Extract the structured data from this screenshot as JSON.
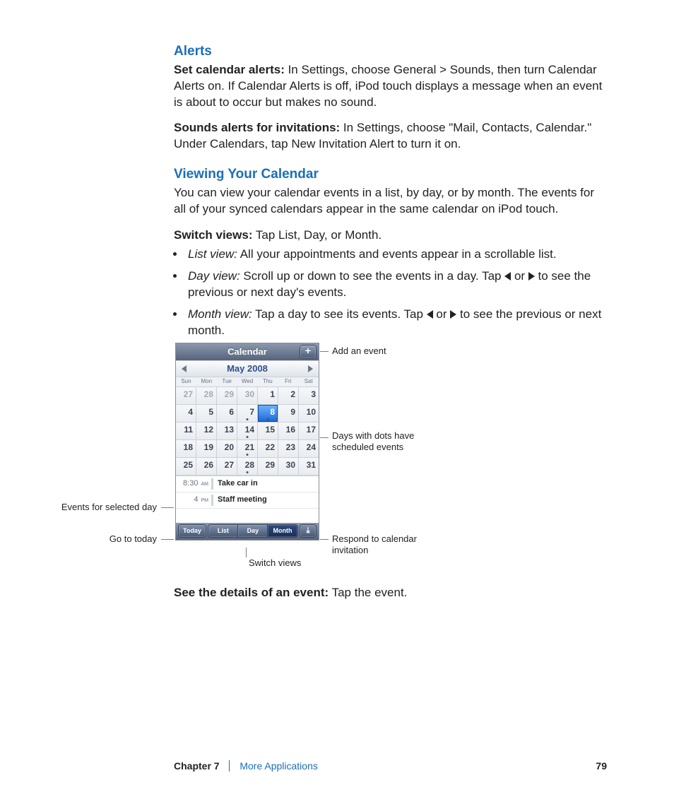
{
  "sections": {
    "alerts": {
      "heading": "Alerts",
      "p1_label": "Set calendar alerts:",
      "p1_body": "  In Settings, choose General > Sounds, then turn Calendar Alerts on. If Calendar Alerts is off, iPod touch displays a message when an event is about to occur but makes no sound.",
      "p2_label": "Sounds alerts for invitations:",
      "p2_body": "  In Settings, choose \"Mail, Contacts, Calendar.\" Under Calendars, tap New Invitation Alert to turn it on."
    },
    "viewing": {
      "heading": "Viewing Your Calendar",
      "intro": "You can view your calendar events in a list, by day, or by month. The events for all of your synced calendars appear in the same calendar on iPod touch.",
      "switch_label": "Switch views:",
      "switch_body": "  Tap List, Day, or Month.",
      "bullets": {
        "b1_label": "List view:",
        "b1_body": "  All your appointments and events appear in a scrollable list.",
        "b2_label": "Day view:",
        "b2_pre": "  Scroll up or down to see the events in a day. Tap ",
        "b2_mid": " or ",
        "b2_post": " to see the previous or next day's events.",
        "b3_label": "Month view:",
        "b3_pre": " Tap a day to see its events. Tap ",
        "b3_mid": " or ",
        "b3_post": " to see the previous or next month."
      },
      "see_label": "See the details of an event:",
      "see_body": "  Tap the event."
    }
  },
  "ipod": {
    "title": "Calendar",
    "add": "+",
    "month": "May 2008",
    "dow": [
      "Sun",
      "Mon",
      "Tue",
      "Wed",
      "Thu",
      "Fri",
      "Sat"
    ],
    "weeks": [
      [
        {
          "n": "27",
          "out": true
        },
        {
          "n": "28",
          "out": true
        },
        {
          "n": "29",
          "out": true
        },
        {
          "n": "30",
          "out": true
        },
        {
          "n": "1"
        },
        {
          "n": "2"
        },
        {
          "n": "3"
        }
      ],
      [
        {
          "n": "4"
        },
        {
          "n": "5"
        },
        {
          "n": "6"
        },
        {
          "n": "7",
          "dot": true
        },
        {
          "n": "8",
          "sel": true,
          "dot": true
        },
        {
          "n": "9"
        },
        {
          "n": "10"
        }
      ],
      [
        {
          "n": "11"
        },
        {
          "n": "12"
        },
        {
          "n": "13"
        },
        {
          "n": "14",
          "dot": true
        },
        {
          "n": "15"
        },
        {
          "n": "16"
        },
        {
          "n": "17"
        }
      ],
      [
        {
          "n": "18"
        },
        {
          "n": "19"
        },
        {
          "n": "20"
        },
        {
          "n": "21",
          "dot": true
        },
        {
          "n": "22"
        },
        {
          "n": "23"
        },
        {
          "n": "24"
        }
      ],
      [
        {
          "n": "25"
        },
        {
          "n": "26"
        },
        {
          "n": "27"
        },
        {
          "n": "28",
          "dot": true
        },
        {
          "n": "29"
        },
        {
          "n": "30"
        },
        {
          "n": "31"
        }
      ]
    ],
    "events": [
      {
        "time": "8:30",
        "ampm": "AM",
        "title": "Take car in"
      },
      {
        "time": "4",
        "ampm": "PM",
        "title": "Staff meeting"
      }
    ],
    "toolbar": {
      "today": "Today",
      "list": "List",
      "day": "Day",
      "month": "Month",
      "inbox": "⤓"
    }
  },
  "callouts": {
    "add": "Add an event",
    "dots": "Days with dots have scheduled events",
    "eventsday": "Events for selected day",
    "today": "Go to today",
    "respond": "Respond to calendar invitation",
    "switch": "Switch views"
  },
  "footer": {
    "chapter": "Chapter 7",
    "title": "More Applications",
    "page": "79"
  }
}
